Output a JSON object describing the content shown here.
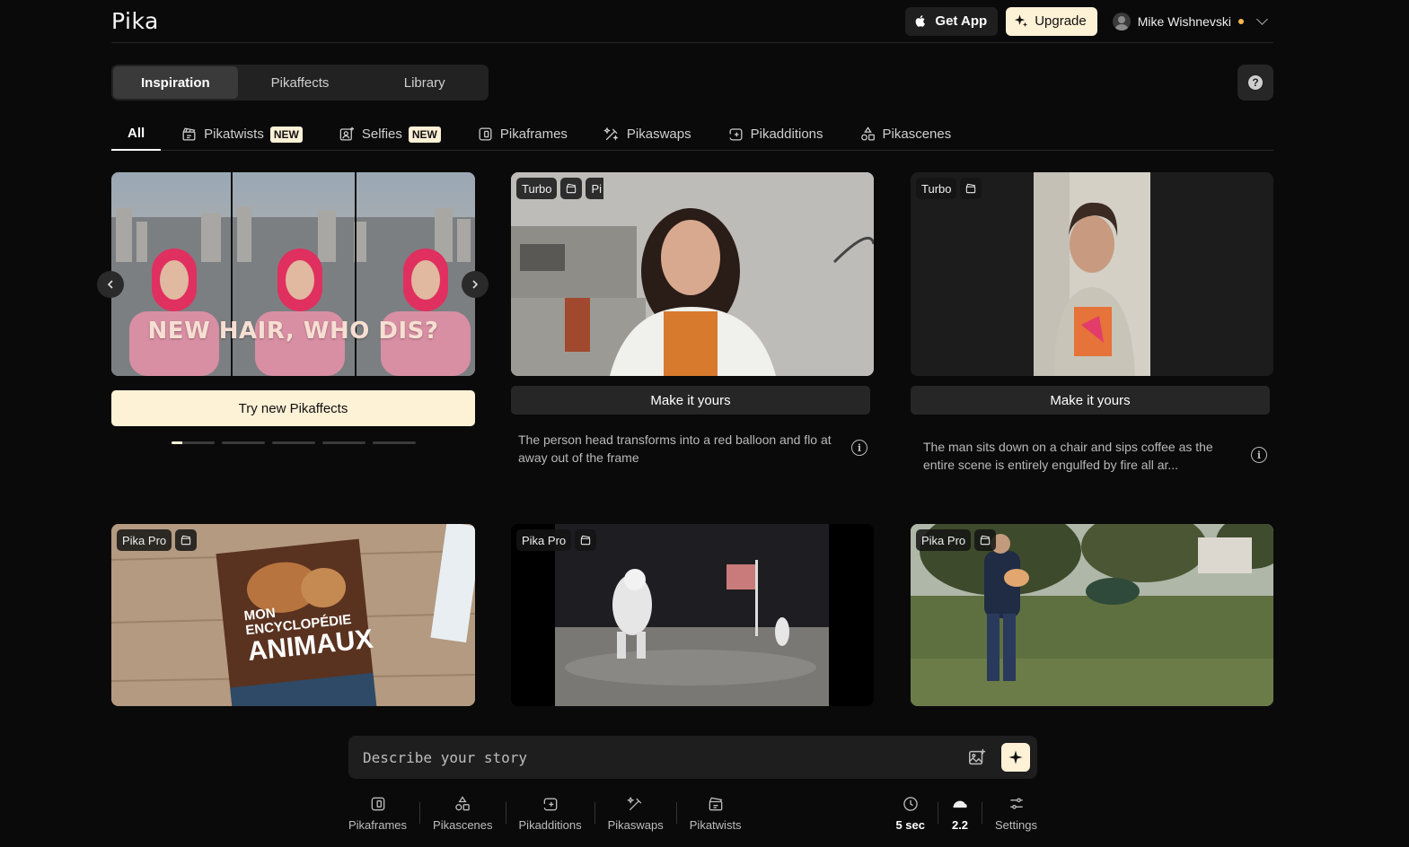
{
  "header": {
    "logo": "Pika",
    "get_app": "Get App",
    "upgrade": "Upgrade",
    "user_name": "Mike Wishnevski"
  },
  "main_tabs": [
    {
      "label": "Inspiration",
      "active": true
    },
    {
      "label": "Pikaffects",
      "active": false
    },
    {
      "label": "Library",
      "active": false
    }
  ],
  "help": "?",
  "filters": [
    {
      "label": "All",
      "icon": "none",
      "active": true
    },
    {
      "label": "Pikatwists",
      "icon": "clapper-icon",
      "badge": "NEW"
    },
    {
      "label": "Selfies",
      "icon": "selfie-icon",
      "badge": "NEW"
    },
    {
      "label": "Pikaframes",
      "icon": "frames-icon"
    },
    {
      "label": "Pikaswaps",
      "icon": "swap-wand-icon"
    },
    {
      "label": "Pikadditions",
      "icon": "additions-icon"
    },
    {
      "label": "Pikascenes",
      "icon": "shapes-icon"
    }
  ],
  "promo": {
    "overlay_text": "NEW HAIR, WHO DIS?",
    "button": "Try new Pikaffects",
    "slides": 5,
    "active_slide": 0
  },
  "cards": [
    {
      "tag": "Turbo",
      "tag2": "Pi",
      "button": "Make it yours",
      "description": "The person head transforms into a red balloon and flo at away out of the frame"
    },
    {
      "tag": "Turbo",
      "button": "Make it yours",
      "description": "The man sits down on a chair and sips coffee as the entire scene is entirely engulfed by fire all ar..."
    },
    {
      "tag": "Pika Pro",
      "book_text": [
        "MON",
        "ENCYCLOPÉDIE",
        "ANIMAUX"
      ]
    },
    {
      "tag": "Pika Pro"
    },
    {
      "tag": "Pika Pro"
    }
  ],
  "prompt": {
    "placeholder": "Describe your story"
  },
  "toolbar": [
    {
      "label": "Pikaframes",
      "icon": "frames-icon"
    },
    {
      "label": "Pikascenes",
      "icon": "shapes-icon"
    },
    {
      "label": "Pikadditions",
      "icon": "additions-icon"
    },
    {
      "label": "Pikaswaps",
      "icon": "swap-wand-icon"
    },
    {
      "label": "Pikatwists",
      "icon": "clapper-icon"
    }
  ],
  "settings": {
    "duration": "5 sec",
    "model": "2.2",
    "settings_label": "Settings"
  }
}
